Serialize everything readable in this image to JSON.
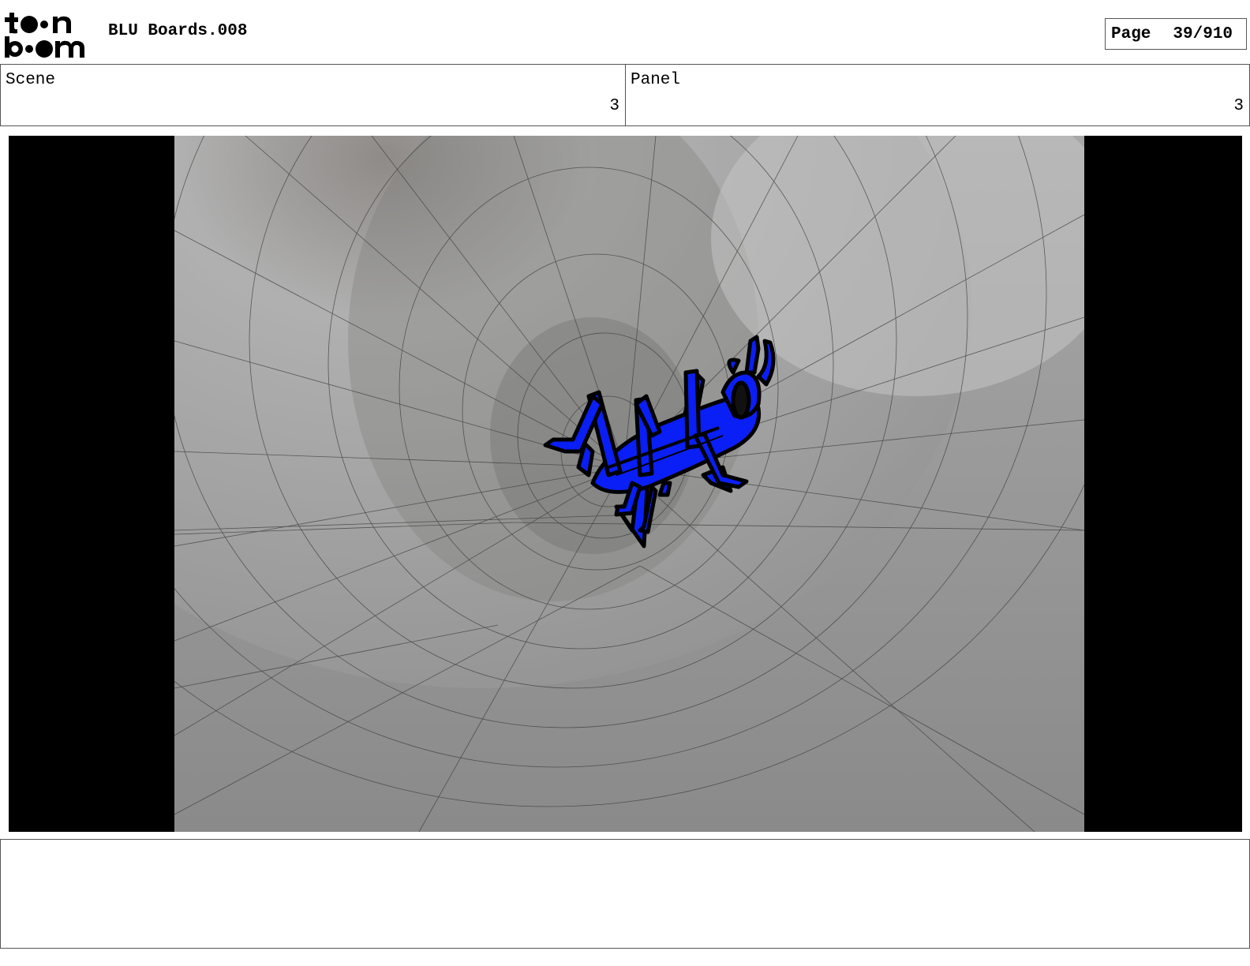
{
  "header": {
    "logo_text": "toonboom",
    "title": "BLU Boards.008",
    "page_label": "Page",
    "page_number": "39/910"
  },
  "fields": {
    "scene_label": "Scene",
    "scene_value": "3",
    "panel_label": "Panel",
    "panel_value": "3"
  },
  "notes": {
    "text": ""
  },
  "colors": {
    "character_fill": "#0a1ff5",
    "surface": "#9a9a9a",
    "letterbox": "#000000"
  }
}
